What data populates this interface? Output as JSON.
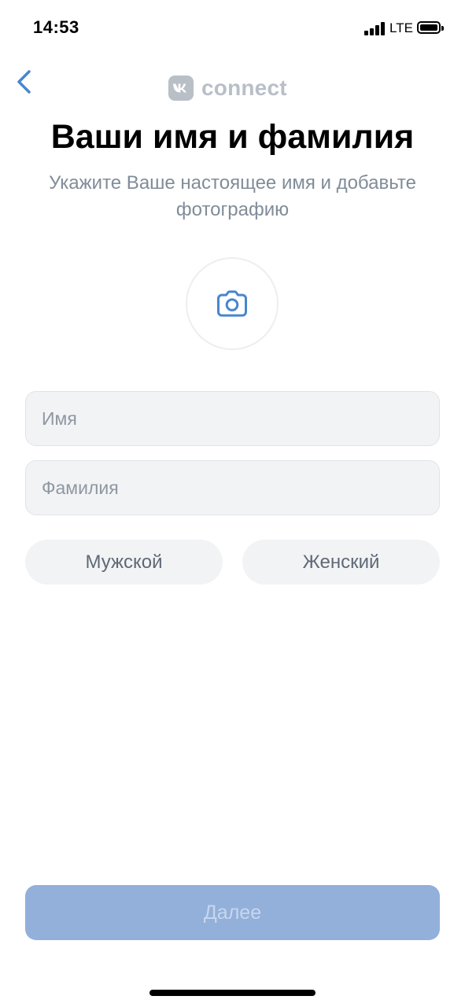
{
  "status_bar": {
    "time": "14:53",
    "network": "LTE"
  },
  "header": {
    "back_icon": "chevron-left-icon",
    "brand_logo_icon": "vk-logo-icon",
    "brand_name": "connect"
  },
  "title": "Ваши имя и фамилия",
  "subtitle": "Укажите Ваше настоящее имя и добавьте фотографию",
  "avatar": {
    "icon": "camera-icon"
  },
  "form": {
    "first_name": {
      "value": "",
      "placeholder": "Имя"
    },
    "last_name": {
      "value": "",
      "placeholder": "Фамилия"
    }
  },
  "gender": {
    "male_label": "Мужской",
    "female_label": "Женский"
  },
  "next_button": {
    "label": "Далее",
    "enabled": false
  },
  "colors": {
    "accent": "#4986cc",
    "muted_text": "#818c99",
    "brand_gray": "#b8bfc7",
    "field_background": "#f2f3f5",
    "next_button_disabled": "#92b0da"
  }
}
